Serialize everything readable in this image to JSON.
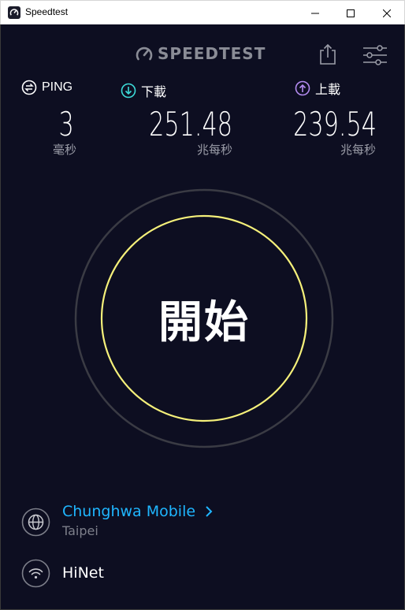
{
  "window": {
    "title": "Speedtest",
    "icons": {
      "minimize": "minimize-icon",
      "maximize": "maximize-icon",
      "close": "close-icon"
    }
  },
  "header": {
    "logo_text": "SPEEDTEST",
    "share_icon": "share-icon",
    "settings_icon": "settings-sliders-icon"
  },
  "stats": {
    "ping": {
      "label": "PING",
      "value": "3",
      "unit": "毫秒",
      "icon": "ping-icon"
    },
    "download": {
      "label": "下載",
      "value": "251.48",
      "unit": "兆每秒",
      "icon": "download-arrow-icon"
    },
    "upload": {
      "label": "上載",
      "value": "239.54",
      "unit": "兆每秒",
      "icon": "upload-arrow-icon"
    }
  },
  "go_button": {
    "label": "開始"
  },
  "provider": {
    "name": "Chunghwa Mobile",
    "location": "Taipei",
    "icon": "globe-icon"
  },
  "network": {
    "name": "HiNet",
    "icon": "wifi-icon"
  },
  "colors": {
    "background": "#0d0e21",
    "accent_blue": "#1fb6ff",
    "download_teal": "#3ddbd9",
    "upload_purple": "#b38bf0",
    "ring_yellow": "#f5f07a",
    "muted_text": "#9b9da8"
  }
}
